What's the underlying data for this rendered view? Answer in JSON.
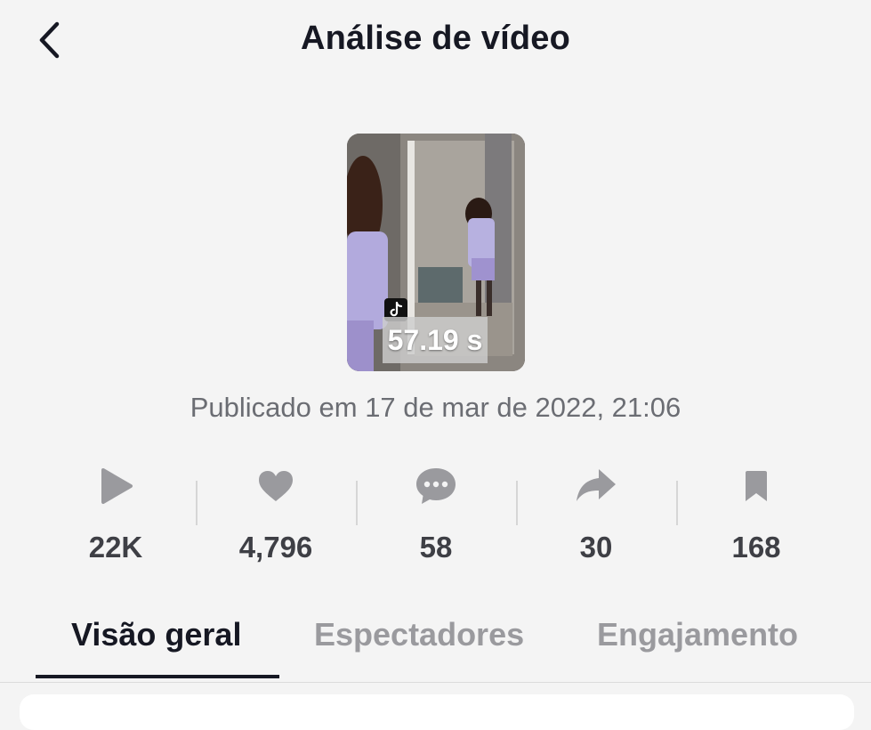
{
  "header": {
    "title": "Análise de vídeo",
    "back_icon": "chevron-left-icon"
  },
  "video": {
    "duration": "57.19 s",
    "badge_icon": "tiktok-logo-icon",
    "published": "Publicado em 17 de mar de 2022, 21:06"
  },
  "stats": [
    {
      "icon": "play-icon",
      "value": "22K"
    },
    {
      "icon": "heart-icon",
      "value": "4,796"
    },
    {
      "icon": "comment-icon",
      "value": "58"
    },
    {
      "icon": "share-icon",
      "value": "30"
    },
    {
      "icon": "bookmark-icon",
      "value": "168"
    }
  ],
  "tabs": [
    {
      "label": "Visão geral",
      "active": true
    },
    {
      "label": "Espectadores",
      "active": false
    },
    {
      "label": "Engajamento",
      "active": false
    }
  ],
  "colors": {
    "background": "#f4f4f4",
    "text_primary": "#161823",
    "text_secondary": "#6b6d73",
    "icon_gray": "#9a9a9e",
    "tab_inactive": "#9a9a9e"
  }
}
